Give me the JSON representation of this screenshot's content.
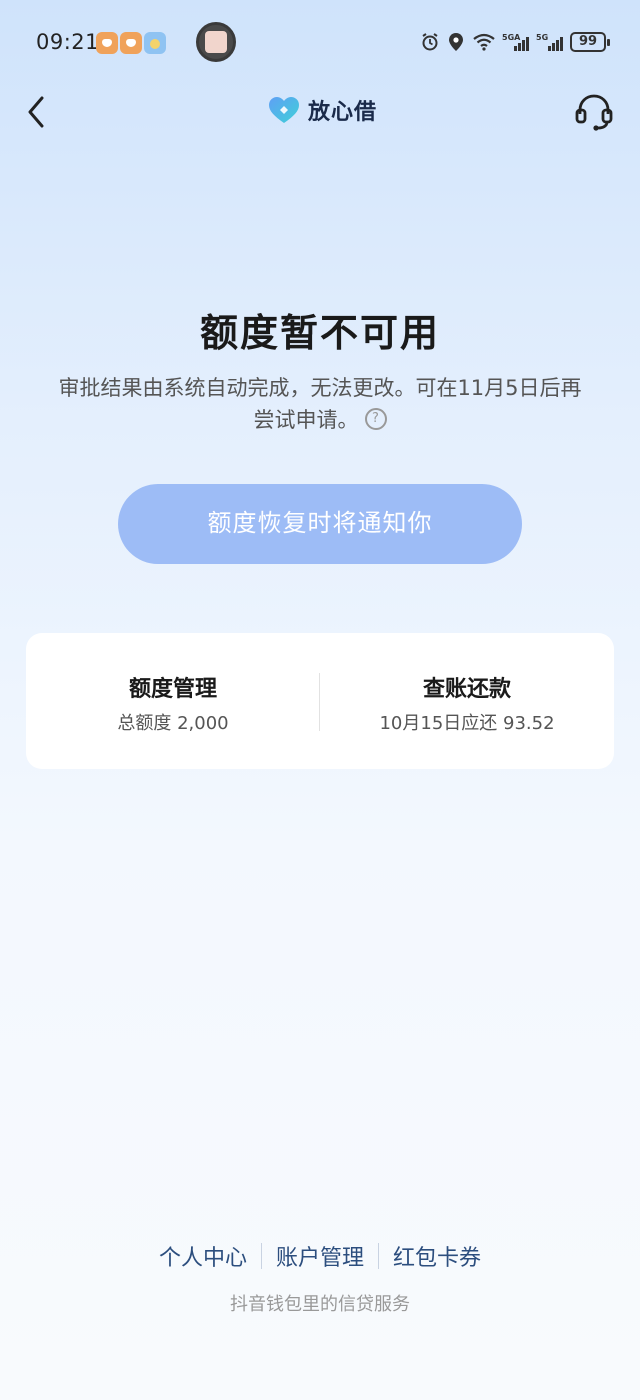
{
  "status_bar": {
    "time": "09:21",
    "battery": "99",
    "notification_icons": [
      "app-notification-icon",
      "app-notification-icon",
      "weather-icon"
    ],
    "system_icons": [
      "alarm-icon",
      "location-icon",
      "wifi-icon",
      "signal-5ga-icon",
      "signal-5g-icon",
      "battery-icon"
    ]
  },
  "nav": {
    "brand_name": "放心借",
    "brand_color": "#1a2a4a"
  },
  "main": {
    "title": "额度暂不可用",
    "description": "审批结果由系统自动完成，无法更改。可在11月5日后再尝试申请。",
    "help_symbol": "?",
    "notify_button": "额度恢复时将通知你",
    "notify_button_color": "#9dbcf6"
  },
  "card": {
    "left_title": "额度管理",
    "left_sub": "总额度 2,000",
    "right_title": "查账还款",
    "right_sub": "10月15日应还 93.52"
  },
  "footer": {
    "links": [
      "个人中心",
      "账户管理",
      "红包卡券"
    ],
    "note": "抖音钱包里的信贷服务",
    "link_color": "#2c4e7e"
  }
}
